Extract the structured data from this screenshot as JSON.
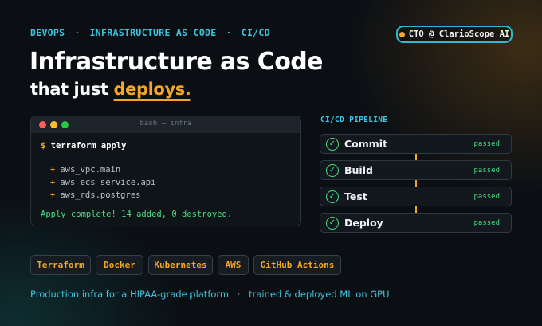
{
  "topline": {
    "items": [
      "DEVOPS",
      "INFRASTRUCTURE AS CODE",
      "CI/CD"
    ],
    "separator": "·"
  },
  "badge": {
    "label": "CTO @ ClarioScope AI"
  },
  "headline": {
    "line1": "Infrastructure as Code",
    "line2_prefix": "that just",
    "line2_accent": "deploys."
  },
  "terminal": {
    "title": "bash — infra",
    "prompt": "$",
    "command": "terraform apply",
    "resources": [
      "aws_vpc.main",
      "aws_ecs_service.api",
      "aws_rds.postgres"
    ],
    "plus": "+",
    "result": "Apply complete! 14 added, 0 destroyed."
  },
  "pipeline": {
    "title": "CI/CD PIPELINE",
    "stages": [
      {
        "name": "Commit",
        "status": "passed"
      },
      {
        "name": "Build",
        "status": "passed"
      },
      {
        "name": "Test",
        "status": "passed"
      },
      {
        "name": "Deploy",
        "status": "passed"
      }
    ]
  },
  "tags": [
    "Terraform",
    "Docker",
    "Kubernetes",
    "AWS",
    "GitHub Actions"
  ],
  "footer": {
    "part1": "Production infra for a HIPAA-grade platform",
    "separator": "·",
    "part2": "trained & deployed ML on GPU"
  },
  "colors": {
    "accent_cyan": "#3fc4e0",
    "accent_orange": "#f5a623",
    "success_green": "#4ade80",
    "background": "#0b0f14"
  }
}
